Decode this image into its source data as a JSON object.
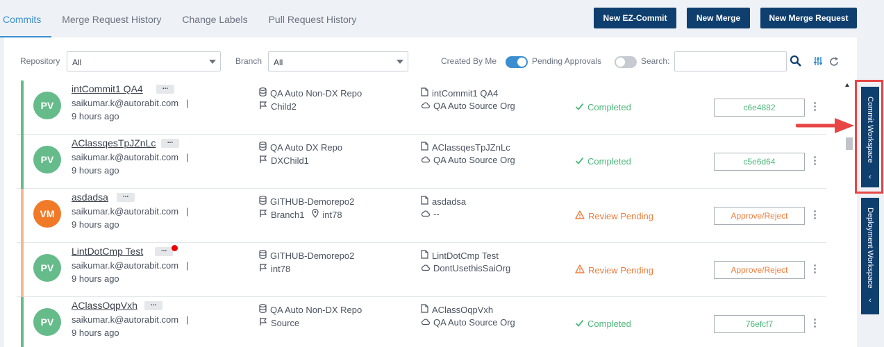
{
  "tabs": [
    "Commits",
    "Merge Request History",
    "Change Labels",
    "Pull Request History"
  ],
  "buttons": {
    "ez_commit": "New EZ-Commit",
    "merge": "New Merge",
    "merge_request": "New Merge Request"
  },
  "filters": {
    "repository_label": "Repository",
    "repository_value": "All",
    "branch_label": "Branch",
    "branch_value": "All",
    "created_by_me_label": "Created By Me",
    "created_by_me": true,
    "pending_approvals_label": "Pending Approvals",
    "pending_approvals": false,
    "search_label": "Search:",
    "search_value": ""
  },
  "colors": {
    "accent": "#3b8fd0",
    "navy": "#0f3f6f",
    "green": "#4cb87a",
    "orange": "#ef7d3c",
    "avatar_green": "#66bb8a",
    "avatar_orange": "#f07a28"
  },
  "rows": [
    {
      "initials": "PV",
      "name": "intCommit1 QA4",
      "email": "saikumar.k@autorabit.com",
      "sep": "|",
      "time": "9 hours ago",
      "repo": "QA Auto Non-DX Repo",
      "branch": "Child2",
      "branch2": "",
      "commit_label": "intCommit1 QA4",
      "org": "QA Auto Source Org",
      "status": "Completed",
      "action": "c6e4882",
      "state": "ok",
      "unread": false
    },
    {
      "initials": "PV",
      "name": "AClassqesTpJZnLc",
      "email": "saikumar.k@autorabit.com",
      "sep": "|",
      "time": "9 hours ago",
      "repo": "QA Auto DX Repo",
      "branch": "DXChild1",
      "branch2": "",
      "commit_label": "AClassqesTpJZnLc",
      "org": "QA Auto Source Org",
      "status": "Completed",
      "action": "c5e6d64",
      "state": "ok",
      "unread": false
    },
    {
      "initials": "VM",
      "name": "asdadsa",
      "email": "saikumar.k@autorabit.com",
      "sep": "|",
      "time": "9 hours ago",
      "repo": "GITHUB-Demorepo2",
      "branch": "Branch1",
      "branch2": "int78",
      "commit_label": "asdadsa",
      "org": "--",
      "status": "Review Pending",
      "action": "Approve/Reject",
      "state": "warn",
      "unread": false
    },
    {
      "initials": "PV",
      "name": "LintDotCmp Test",
      "email": "saikumar.k@autorabit.com",
      "sep": "|",
      "time": "9 hours ago",
      "repo": "GITHUB-Demorepo2",
      "branch": "int78",
      "branch2": "",
      "commit_label": "LintDotCmp Test",
      "org": "DontUsethisSaiOrg",
      "status": "Review Pending",
      "action": "Approve/Reject",
      "state": "warn",
      "unread": true
    },
    {
      "initials": "PV",
      "name": "AClassOqpVxh",
      "email": "saikumar.k@autorabit.com",
      "sep": "|",
      "time": "9 hours ago",
      "repo": "QA Auto Non-DX Repo",
      "branch": "Source",
      "branch2": "",
      "commit_label": "AClassOqpVxh",
      "org": "QA Auto Source Org",
      "status": "Completed",
      "action": "76efcf7",
      "state": "ok",
      "unread": false
    }
  ],
  "side_tabs": {
    "commit": "Commit Workspace",
    "deployment": "Deployment Workspace"
  }
}
